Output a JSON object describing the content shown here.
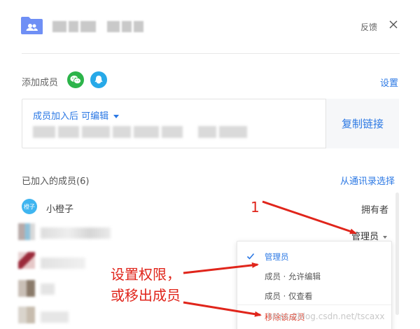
{
  "header": {
    "feedback_label": "反馈"
  },
  "add_members": {
    "label": "添加成员",
    "settings_label": "设置"
  },
  "link_box": {
    "permission_label": "成员加入后 可编辑",
    "copy_button": "复制链接"
  },
  "members": {
    "joined_label": "已加入的成员(6)",
    "from_contacts": "从通讯录选择",
    "me": {
      "avatar_text": "橙子",
      "name": "小橙子",
      "role": "拥有者"
    },
    "second_role": "管理员"
  },
  "role_menu": {
    "items": [
      {
        "label": "管理员",
        "selected": true
      },
      {
        "label": "成员 · 允许编辑",
        "selected": false
      },
      {
        "label": "成员 · 仅查看",
        "selected": false
      }
    ],
    "remove_label": "移除该成员"
  },
  "annotations": {
    "number": "1",
    "line1": "设置权限，",
    "line2": "或移出成员"
  },
  "watermark": "https://blog.csdn.net/tscaxx",
  "colors": {
    "accent": "#2b78e4",
    "wechat": "#2cb44a",
    "qq": "#27a9e8",
    "annotation": "#e0251b",
    "danger": "#e0412f"
  }
}
